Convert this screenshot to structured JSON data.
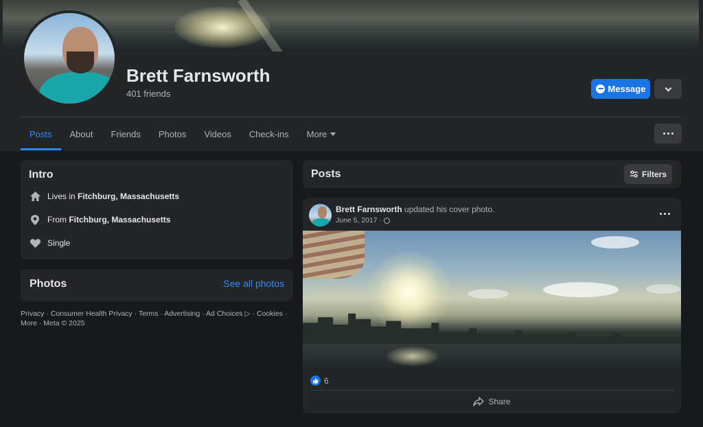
{
  "profile": {
    "name": "Brett Farnsworth",
    "friends": "401 friends",
    "message_label": "Message"
  },
  "tabs": [
    {
      "label": "Posts",
      "active": true
    },
    {
      "label": "About"
    },
    {
      "label": "Friends"
    },
    {
      "label": "Photos"
    },
    {
      "label": "Videos"
    },
    {
      "label": "Check-ins"
    },
    {
      "label": "More"
    }
  ],
  "intro": {
    "title": "Intro",
    "lives_prefix": "Lives in",
    "lives_place": "Fitchburg, Massachusetts",
    "from_prefix": "From",
    "from_place": "Fitchburg, Massachusetts",
    "relationship": "Single"
  },
  "photos_card": {
    "title": "Photos",
    "see_all": "See all photos"
  },
  "footer": {
    "line1": "Privacy · Consumer Health Privacy · Terms · Advertising · Ad Choices ▷ · Cookies ·",
    "line2": "More · Meta © 2025"
  },
  "posts": {
    "title": "Posts",
    "filters_label": "Filters"
  },
  "post": {
    "author": "Brett Farnsworth",
    "action": " updated his cover photo.",
    "date": "June 5, 2017 ·",
    "likes": "6",
    "share_label": "Share"
  },
  "colors": {
    "accent": "#2d88ff",
    "button_blue": "#1b74e4",
    "card": "#242526",
    "background": "#18191a"
  },
  "icons": [
    "messenger-icon",
    "chevron-down-icon",
    "more-dots-icon",
    "home-icon",
    "location-pin-icon",
    "heart-icon",
    "filters-icon",
    "globe-icon",
    "like-icon",
    "share-icon"
  ]
}
